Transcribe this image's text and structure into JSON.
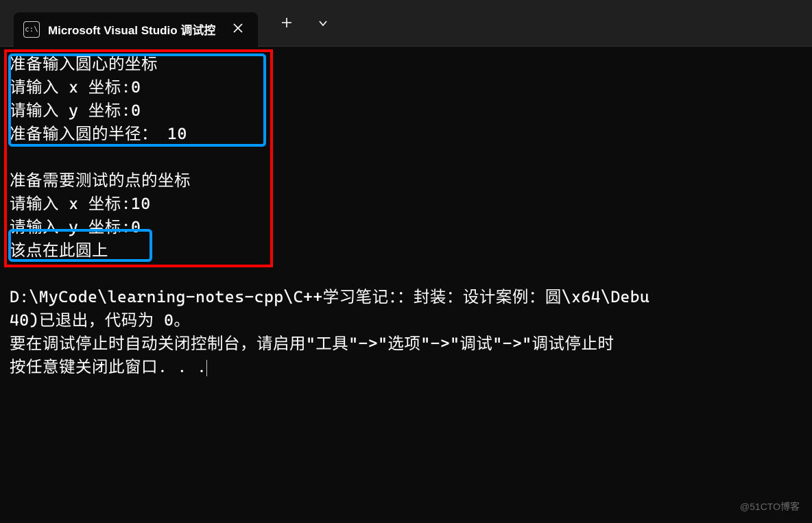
{
  "tab": {
    "icon_text": "c:\\",
    "title": "Microsoft Visual Studio 调试控"
  },
  "console": {
    "line1": "准备输入圆心的坐标",
    "line2": "请输入 x 坐标:0",
    "line3": "请输入 y 坐标:0",
    "line4": "准备输入圆的半径： 10",
    "blank1": "",
    "line5": "准备需要测试的点的坐标",
    "line6": "请输入 x 坐标:10",
    "line7": "请输入 y 坐标:0",
    "line8": "该点在此圆上",
    "blank2": "",
    "line9": "D:\\MyCode\\learning-notes-cpp\\C++学习笔记：：封装：设计案例：圆\\x64\\Debu",
    "line10": "40)已退出，代码为 0。",
    "line11": "要在调试停止时自动关闭控制台，请启用\"工具\"->\"选项\"->\"调试\"->\"调试停止时",
    "line12": "按任意键关闭此窗口. . ."
  },
  "watermark": "@51CTO博客"
}
